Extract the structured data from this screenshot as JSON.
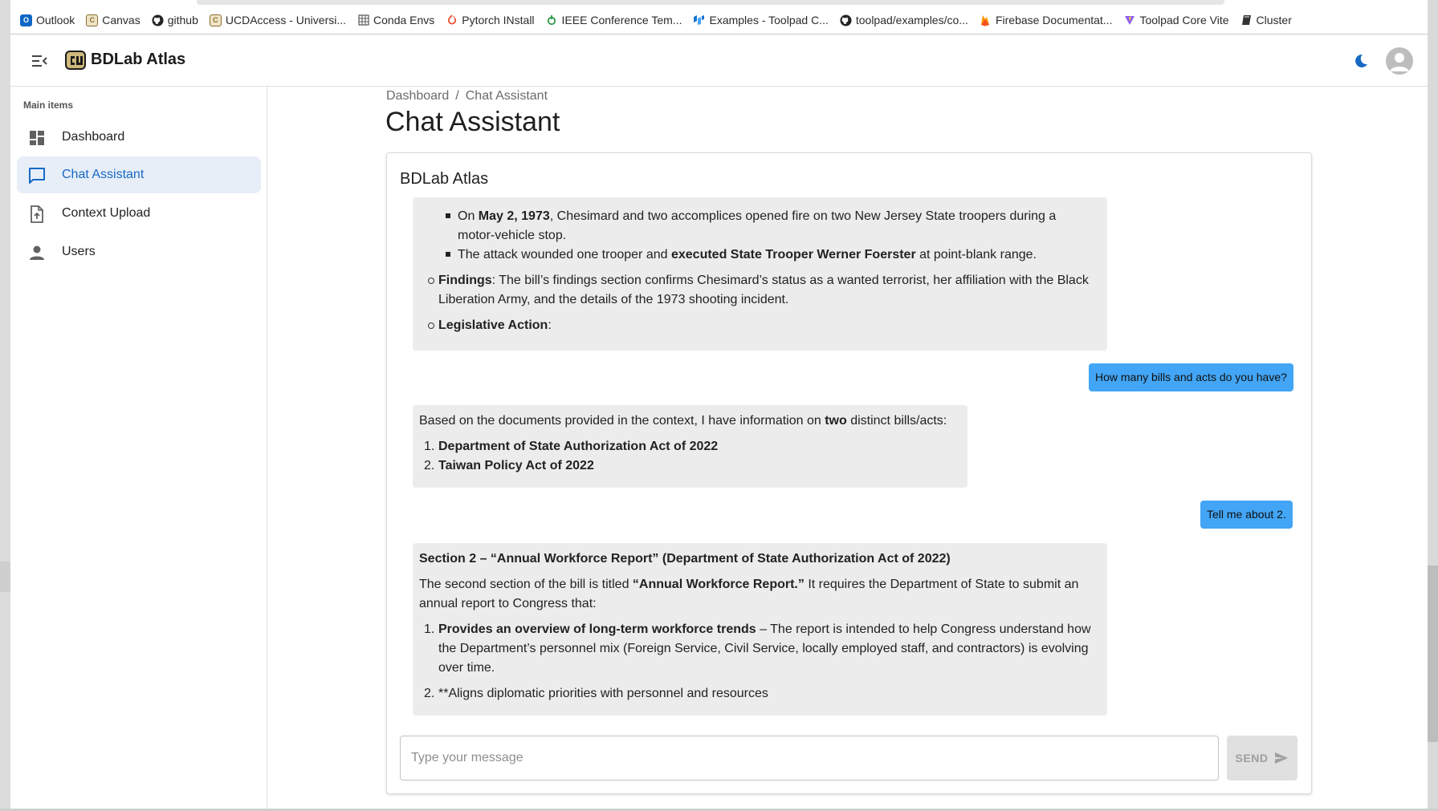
{
  "bookmarks": [
    {
      "label": "Outlook",
      "icon": "outlook-icon",
      "color": "#0a66c2"
    },
    {
      "label": "Canvas",
      "icon": "cu-logo-icon",
      "color": "#b59a57"
    },
    {
      "label": "github",
      "icon": "github-icon",
      "color": "#222222"
    },
    {
      "label": "UCDAccess - Universi...",
      "icon": "cu-logo-icon",
      "color": "#b59a57"
    },
    {
      "label": "Conda Envs",
      "icon": "table-icon",
      "color": "#555555"
    },
    {
      "label": "Pytorch INstall",
      "icon": "pytorch-icon",
      "color": "#ee4c2c"
    },
    {
      "label": "IEEE Conference Tem...",
      "icon": "leaf-icon",
      "color": "#2e9a4a"
    },
    {
      "label": "Examples - Toolpad C...",
      "icon": "toolpad-icon",
      "color": "#1976d2"
    },
    {
      "label": "toolpad/examples/co...",
      "icon": "github-icon",
      "color": "#222222"
    },
    {
      "label": "Firebase Documentat...",
      "icon": "firebase-icon",
      "color": "#ff8f00"
    },
    {
      "label": "Toolpad Core Vite",
      "icon": "vite-icon",
      "color": "#8a5cf6"
    },
    {
      "label": "Cluster",
      "icon": "book-icon",
      "color": "#333333"
    }
  ],
  "header": {
    "app_title": "BDLab Atlas",
    "menu_icon": "menu-collapse-icon",
    "theme_icon": "moon-icon",
    "accent": "#1769c4"
  },
  "sidebar": {
    "subheader": "Main items",
    "items": [
      {
        "label": "Dashboard",
        "icon": "dashboard-icon",
        "active": false
      },
      {
        "label": "Chat Assistant",
        "icon": "chat-icon",
        "active": true
      },
      {
        "label": "Context Upload",
        "icon": "upload-file-icon",
        "active": false
      },
      {
        "label": "Users",
        "icon": "person-icon",
        "active": false
      }
    ]
  },
  "breadcrumb": {
    "items": [
      "Dashboard",
      "Chat Assistant"
    ],
    "separator": "/"
  },
  "page_title": "Chat Assistant",
  "chat": {
    "title": "BDLab Atlas",
    "msg1": {
      "l1_a": "On ",
      "l1_b": "May 2, 1973",
      "l1_c": ", Chesimard and two accomplices opened fire on two New Jersey State troopers during a",
      "l2": "motor-vehicle stop.",
      "l3_a": "The attack wounded one trooper and ",
      "l3_b": "executed State Trooper Werner Foerster",
      "l3_c": " at point-blank range.",
      "l4_a": "Findings",
      "l4_b": ": The bill’s findings section confirms Chesimard’s status as a wanted terrorist, her affiliation with the Black",
      "l5": "Liberation Army, and the details of the 1973 shooting incident.",
      "l6_a": "Legislative Action",
      "l6_b": ":"
    },
    "user1": "How many bills and acts do you have?",
    "msg2": {
      "l1_a": "Based on the documents provided in the context, I have information on ",
      "l1_b": "two",
      "l1_c": " distinct bills/acts:",
      "items": [
        "Department of State Authorization Act of 2022",
        "Taiwan Policy Act of 2022"
      ]
    },
    "user2": "Tell me about 2.",
    "msg3": {
      "heading": "Section 2 – “Annual Workforce Report” (Department of State Authorization Act of 2022)",
      "p1_a": "The second section of the bill is titled ",
      "p1_b": "“Annual Workforce Report.”",
      "p1_c": " It requires the Department of State to submit an",
      "p2": "annual report to Congress that:",
      "i1_a": "Provides an overview of long-term workforce trends",
      "i1_b": " – The report is intended to help Congress understand how",
      "i1_l2": "the Department’s personnel mix (Foreign Service, Civil Service, locally employed staff, and contractors) is evolving",
      "i1_l3": "over time.",
      "i2": "**Aligns diplomatic priorities with personnel and resources"
    },
    "input_placeholder": "Type your message",
    "send_label": "SEND",
    "send_icon": "send-icon"
  }
}
